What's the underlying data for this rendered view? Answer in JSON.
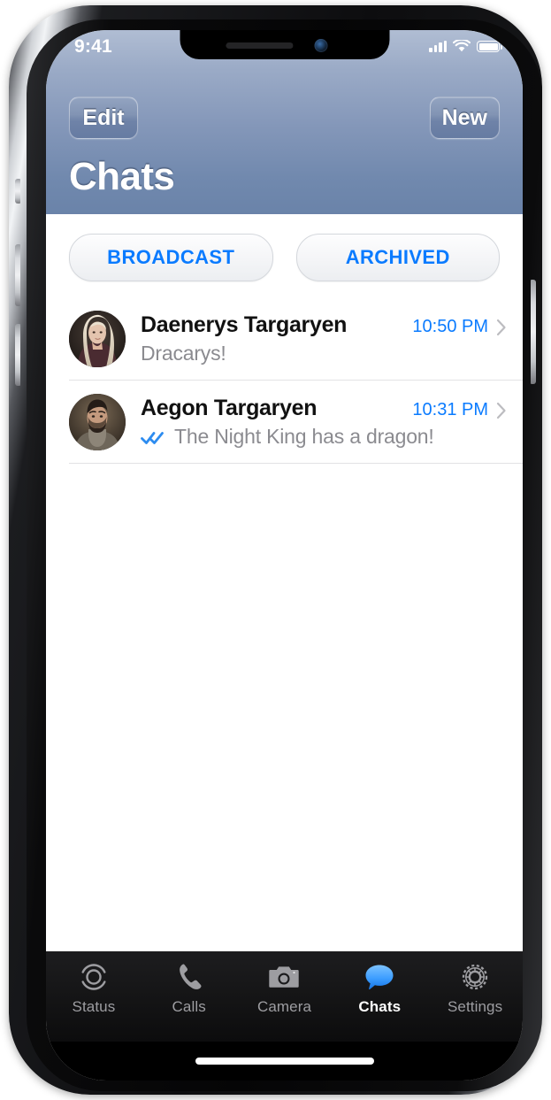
{
  "status_bar": {
    "time": "9:41",
    "icons": [
      "signal-bars-icon",
      "wifi-icon",
      "battery-icon"
    ]
  },
  "header": {
    "title": "Chats",
    "edit_label": "Edit",
    "new_label": "New",
    "gradient_top": "#b0bdd3",
    "gradient_bottom": "#6a83a9"
  },
  "segments": [
    {
      "label": "BROADCAST",
      "name": "broadcast"
    },
    {
      "label": "ARCHIVED",
      "name": "archived"
    }
  ],
  "accent_color": "#0a7bff",
  "chats": [
    {
      "name": "Daenerys Targaryen",
      "preview": "Dracarys!",
      "time": "10:50 PM",
      "read_receipt": false,
      "avatar": "daenerys-avatar"
    },
    {
      "name": "Aegon Targaryen",
      "preview": "The Night King has a dragon!",
      "time": "10:31 PM",
      "read_receipt": true,
      "avatar": "aegon-avatar"
    }
  ],
  "tabs": [
    {
      "label": "Status",
      "icon": "status-rings-icon",
      "active": false
    },
    {
      "label": "Calls",
      "icon": "phone-icon",
      "active": false
    },
    {
      "label": "Camera",
      "icon": "camera-icon",
      "active": false
    },
    {
      "label": "Chats",
      "icon": "chat-bubble-icon",
      "active": true
    },
    {
      "label": "Settings",
      "icon": "gear-icon",
      "active": false
    }
  ]
}
